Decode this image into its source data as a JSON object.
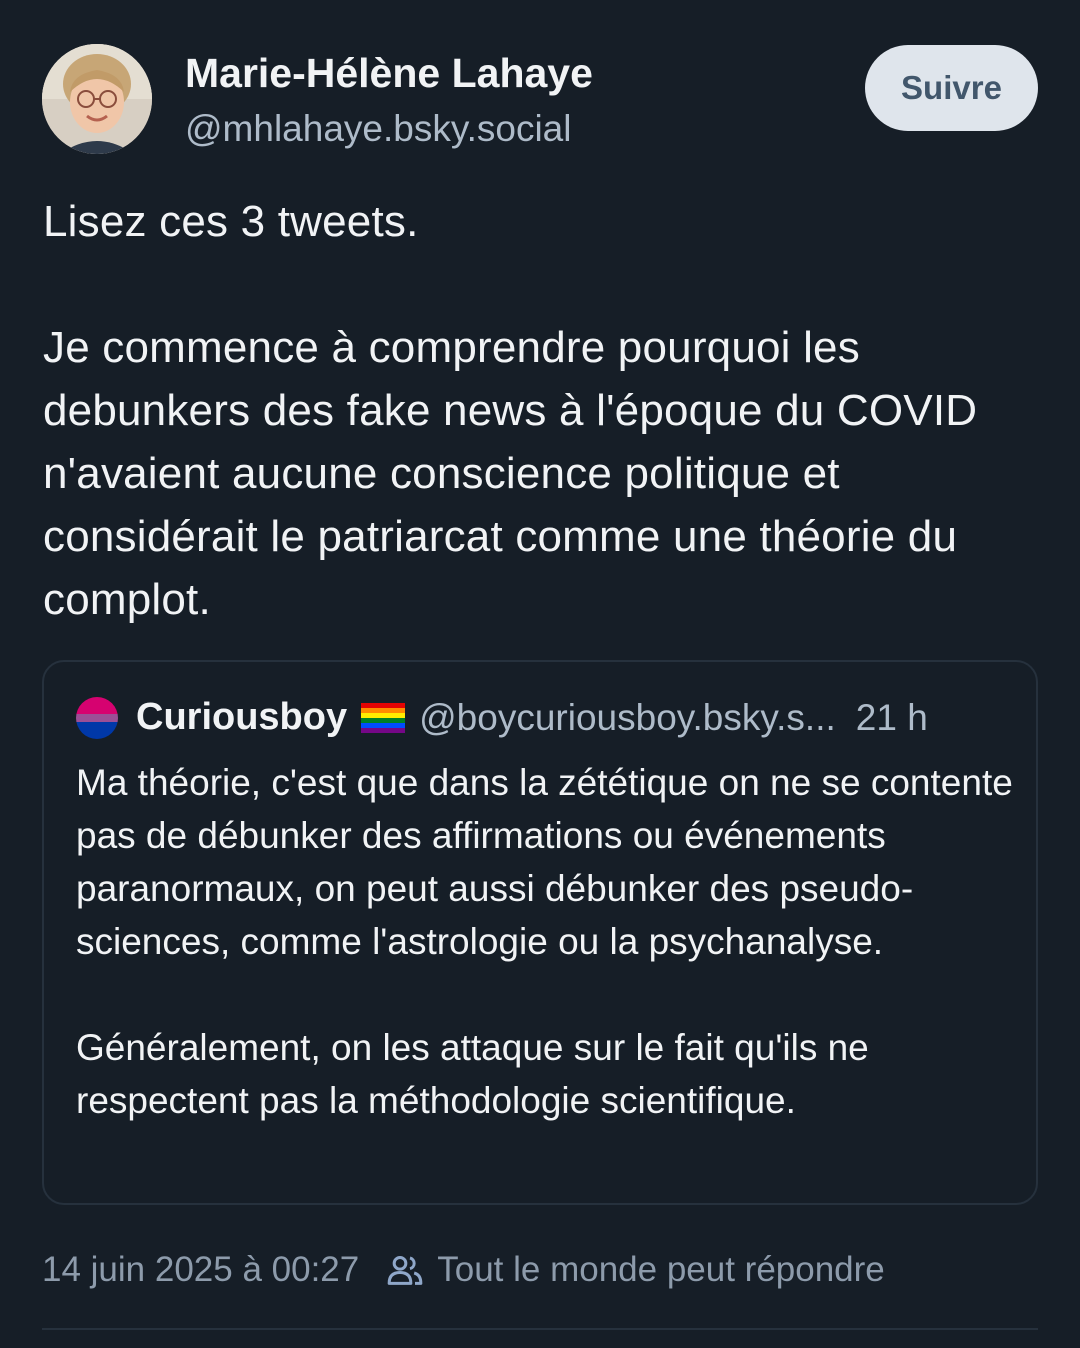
{
  "post": {
    "author": {
      "name": "Marie-Hélène Lahaye",
      "handle": "@mhlahaye.bsky.social"
    },
    "follow_label": "Suivre",
    "text": "Lisez ces 3 tweets.\n\nJe commence à comprendre pourquoi les debunkers des fake news à l'époque du COVID n'avaient aucune conscience politique et considérait le patriarcat comme une théorie du complot.",
    "timestamp": "14 juin 2025 à 00:27",
    "reply_setting": "Tout le monde peut répondre",
    "reply_setting_icon": "people-icon"
  },
  "quote": {
    "author": {
      "name": "Curiousboy",
      "flag_icon": "rainbow-flag-icon",
      "handle": "@boycuriousboy.bsky.s...",
      "time": "21 h"
    },
    "text": "Ma théorie, c'est que dans la zététique on ne se contente pas de débunker des affirmations ou événements paranormaux, on peut aussi débunker des pseudo-sciences, comme l'astrologie ou la psychanalyse.\n\nGénéralement, on les attaque sur le fait qu'ils ne respectent pas la méthodologie scientifique."
  },
  "colors": {
    "background": "#161e27",
    "text_primary": "#f1f3f5",
    "text_secondary": "#aebbc9",
    "border": "#26313d",
    "button_bg": "#dfe5ec",
    "button_text": "#42576c"
  }
}
